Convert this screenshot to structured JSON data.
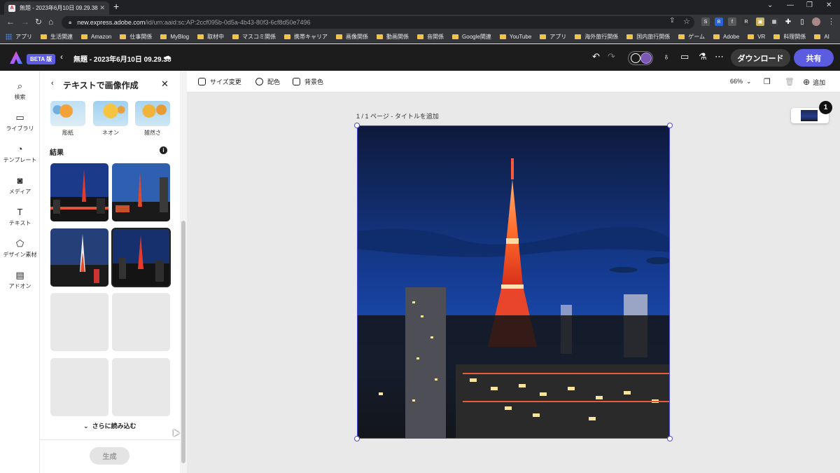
{
  "browser": {
    "tab_title": "無題 - 2023年6月10日 09.29.38",
    "url_host": "new.express.adobe.com",
    "url_path": "/id/urn:aaid:sc:AP:2ccf095b-0d5a-4b43-80f3-6cf8d50e7496",
    "bookmarks": [
      "アプリ",
      "生活関連",
      "Amazon",
      "仕事関係",
      "MyBlog",
      "取材中",
      "マスコミ関係",
      "携帯キャリア",
      "画像関係",
      "動画関係",
      "音関係",
      "Google関連",
      "YouTube",
      "アプリ",
      "海外旅行関係",
      "国内旅行関係",
      "ゲーム",
      "Adobe",
      "VR",
      "料理関係",
      "AI"
    ]
  },
  "header": {
    "beta_label": "BETA 版",
    "doc_title": "無題 - 2023年6月10日 09.29.38",
    "download_label": "ダウンロード",
    "share_label": "共有"
  },
  "rail": [
    {
      "label": "検索",
      "icon": "search-icon"
    },
    {
      "label": "ライブラリ",
      "icon": "folder-icon"
    },
    {
      "label": "テンプレート",
      "icon": "template-icon"
    },
    {
      "label": "メディア",
      "icon": "media-icon"
    },
    {
      "label": "テキスト",
      "icon": "text-icon"
    },
    {
      "label": "デザイン素材",
      "icon": "shapes-icon"
    },
    {
      "label": "アドオン",
      "icon": "addon-icon"
    }
  ],
  "panel": {
    "title": "テキストで画像作成",
    "styles": [
      "彫紙",
      "ネオン",
      "雑然さ"
    ],
    "results_heading": "結果",
    "load_more_label": "さらに読み込む",
    "generate_label": "生成"
  },
  "toolbar": {
    "resize_label": "サイズ変更",
    "color_label": "配色",
    "background_label": "背景色",
    "zoom": "66%",
    "add_label": "追加"
  },
  "canvas": {
    "page_label": "1 / 1 ページ - タイトルを追加",
    "page_count_badge": "1"
  }
}
